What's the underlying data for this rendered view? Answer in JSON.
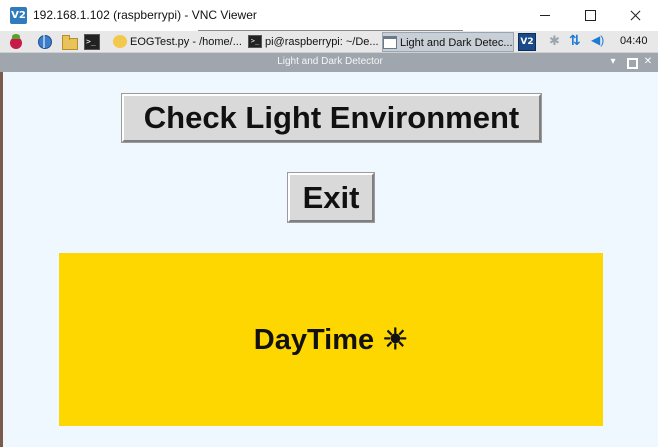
{
  "vnc_window": {
    "logo": "V2",
    "title": "192.168.1.102 (raspberrypi) - VNC Viewer",
    "controls": [
      "minimize-icon",
      "maximize-icon",
      "close-icon"
    ]
  },
  "taskbar": {
    "launchers": [
      "raspberry-menu-icon",
      "web-browser-icon",
      "file-manager-icon",
      "terminal-icon"
    ],
    "terminal_glyph": ">_",
    "tasks": [
      {
        "label": "EOGTest.py - /home/...",
        "icon": "python-editor-icon"
      },
      {
        "label": "pi@raspberrypi: ~/De...",
        "icon": "terminal-icon"
      },
      {
        "label": "Light and Dark Detec...",
        "icon": "window-icon",
        "active": true
      }
    ],
    "tray": {
      "vnc_label": "V2",
      "bluetooth_glyph": "✱",
      "network_glyph": "⇅",
      "volume_glyph": "◀)",
      "clock": "04:40"
    }
  },
  "app_window": {
    "title": "Light and Dark Detector",
    "controls": {
      "minimize": "▾",
      "close": "✕"
    }
  },
  "main": {
    "check_button": "Check Light Environment",
    "exit_button": "Exit",
    "result": {
      "text": "DayTime ☀",
      "background": "#ffd700"
    }
  },
  "colors": {
    "content_background": "#f0f8ff",
    "button_face": "#d9d9d9",
    "titlebar": "#a0a6ad"
  }
}
